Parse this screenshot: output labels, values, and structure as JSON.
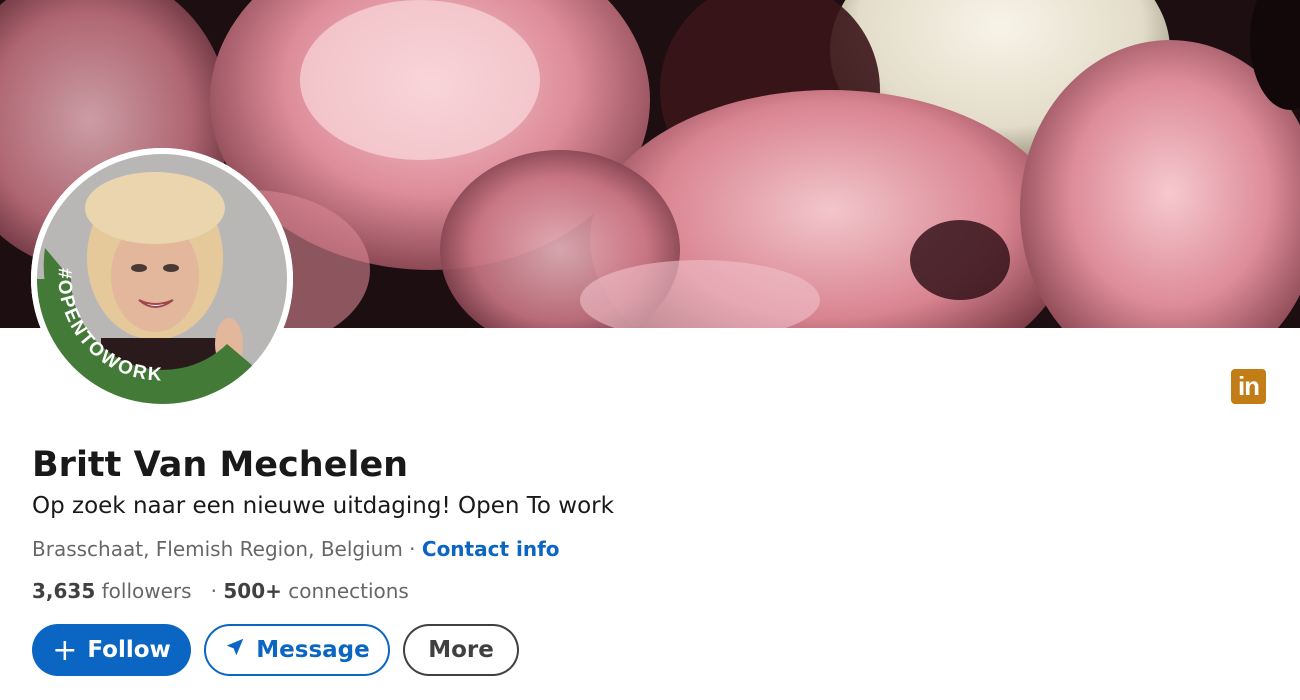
{
  "profile": {
    "name": "Britt Van Mechelen",
    "headline": "Op zoek naar een nieuwe uitdaging! Open To work",
    "location": "Brasschaat, Flemish Region, Belgium",
    "separator": "·",
    "contact_info_label": "Contact info",
    "followers_count": "3,635",
    "followers_label": "followers",
    "connections_separator": "·",
    "connections_count": "500+",
    "connections_label": "connections",
    "open_to_work_badge": "#OPENTOWORK"
  },
  "actions": {
    "follow_icon": "+",
    "follow_label": "Follow",
    "message_label": "Message",
    "more_label": "More"
  },
  "brand": {
    "logo_text": "in",
    "logo_icon": "linkedin-icon"
  },
  "colors": {
    "accent": "#0a66c2",
    "open_to_work_green": "#3f7a35",
    "logo_bg": "#c37d16"
  }
}
